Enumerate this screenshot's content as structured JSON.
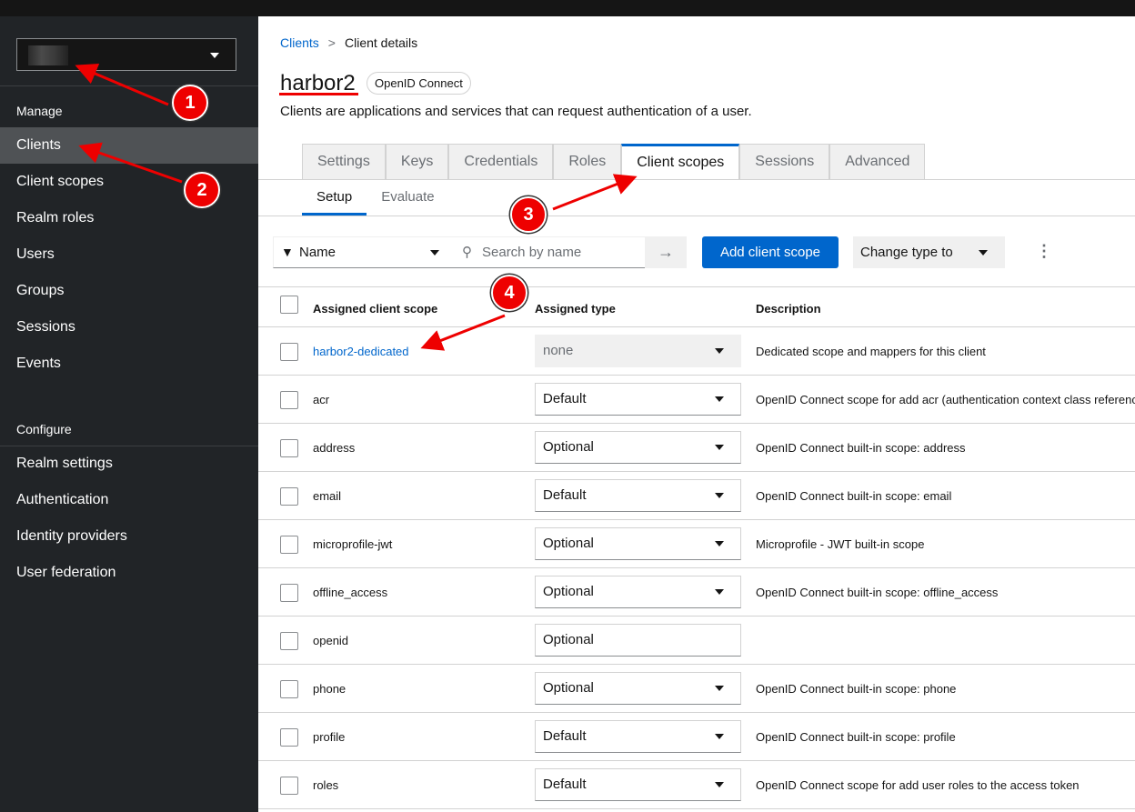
{
  "sidebar": {
    "realm_selector": "",
    "sections": {
      "manage": "Manage",
      "configure": "Configure"
    },
    "manage_items": [
      "Clients",
      "Client scopes",
      "Realm roles",
      "Users",
      "Groups",
      "Sessions",
      "Events"
    ],
    "configure_items": [
      "Realm settings",
      "Authentication",
      "Identity providers",
      "User federation"
    ]
  },
  "breadcrumb": {
    "parent": "Clients",
    "separator": ">",
    "current": "Client details"
  },
  "header": {
    "title": "harbor2",
    "badge": "OpenID Connect",
    "subtitle": "Clients are applications and services that can request authentication of a user."
  },
  "tabs": [
    "Settings",
    "Keys",
    "Credentials",
    "Roles",
    "Client scopes",
    "Sessions",
    "Advanced"
  ],
  "subtabs": [
    "Setup",
    "Evaluate"
  ],
  "toolbar": {
    "filter": "Name",
    "search_placeholder": "Search by name",
    "add": "Add client scope",
    "change_type": "Change type to"
  },
  "table": {
    "headers": [
      "Assigned client scope",
      "Assigned type",
      "Description"
    ],
    "rows": [
      {
        "name": "harbor2-dedicated",
        "type": "none",
        "desc": "Dedicated scope and mappers for this client"
      },
      {
        "name": "acr",
        "type": "Default",
        "desc": "OpenID Connect scope for add acr (authentication context class reference)"
      },
      {
        "name": "address",
        "type": "Optional",
        "desc": "OpenID Connect built-in scope: address"
      },
      {
        "name": "email",
        "type": "Default",
        "desc": "OpenID Connect built-in scope: email"
      },
      {
        "name": "microprofile-jwt",
        "type": "Optional",
        "desc": "Microprofile - JWT built-in scope"
      },
      {
        "name": "offline_access",
        "type": "Optional",
        "desc": "OpenID Connect built-in scope: offline_access"
      },
      {
        "name": "openid",
        "type": "Optional",
        "desc": ""
      },
      {
        "name": "phone",
        "type": "Optional",
        "desc": "OpenID Connect built-in scope: phone"
      },
      {
        "name": "profile",
        "type": "Default",
        "desc": "OpenID Connect built-in scope: profile"
      },
      {
        "name": "roles",
        "type": "Default",
        "desc": "OpenID Connect scope for add user roles to the access token"
      }
    ]
  },
  "annotations": [
    "1",
    "2",
    "3",
    "4"
  ]
}
